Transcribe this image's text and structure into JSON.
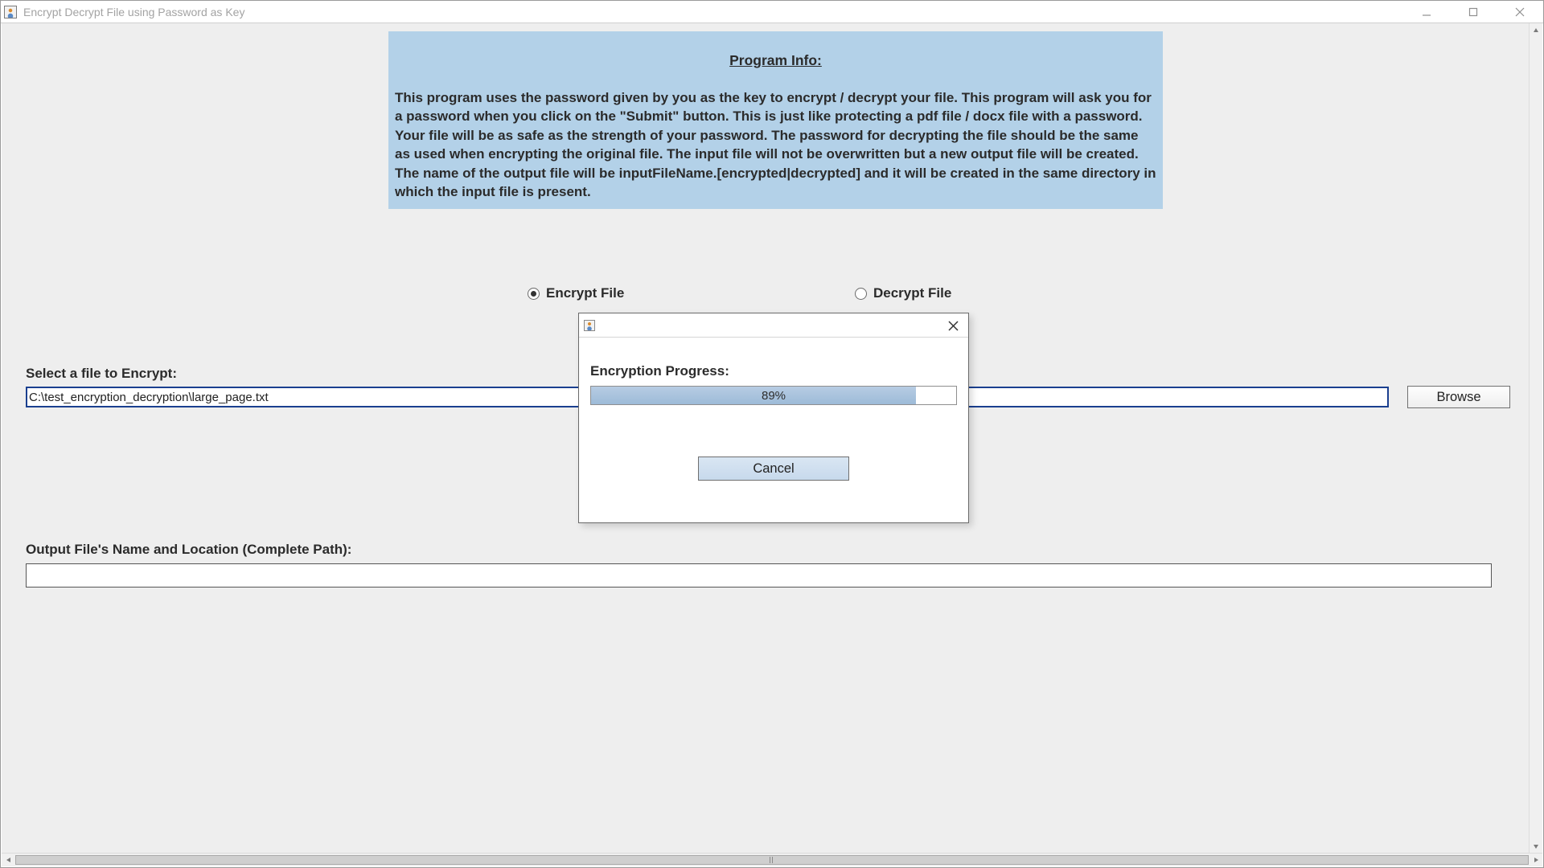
{
  "window": {
    "title": "Encrypt Decrypt File using Password as Key"
  },
  "info": {
    "heading": "Program Info:",
    "body": "This program uses the password given by you as the key to encrypt / decrypt your file. This program will ask you for a password when you click on the \"Submit\" button. This is just like protecting a pdf file / docx file with a password. Your file will be as safe as the strength of your password. The password for decrypting the file should be the same as used when encrypting the original file. The input file will not be overwritten but a new output file will be created. The name of the output file will be inputFileName.[encrypted|decrypted] and it will be created in the same directory in which the input file is present."
  },
  "mode": {
    "encrypt_label": "Encrypt File",
    "decrypt_label": "Decrypt File",
    "selected": "encrypt"
  },
  "input": {
    "label": "Select a file to Encrypt:",
    "value": "C:\\test_encryption_decryption\\large_page.txt",
    "browse_label": "Browse"
  },
  "output": {
    "label": "Output File's Name and Location (Complete Path):",
    "value": ""
  },
  "dialog": {
    "progress_label": "Encryption Progress:",
    "percent_text": "89%",
    "percent_value": 89,
    "cancel_label": "Cancel"
  }
}
